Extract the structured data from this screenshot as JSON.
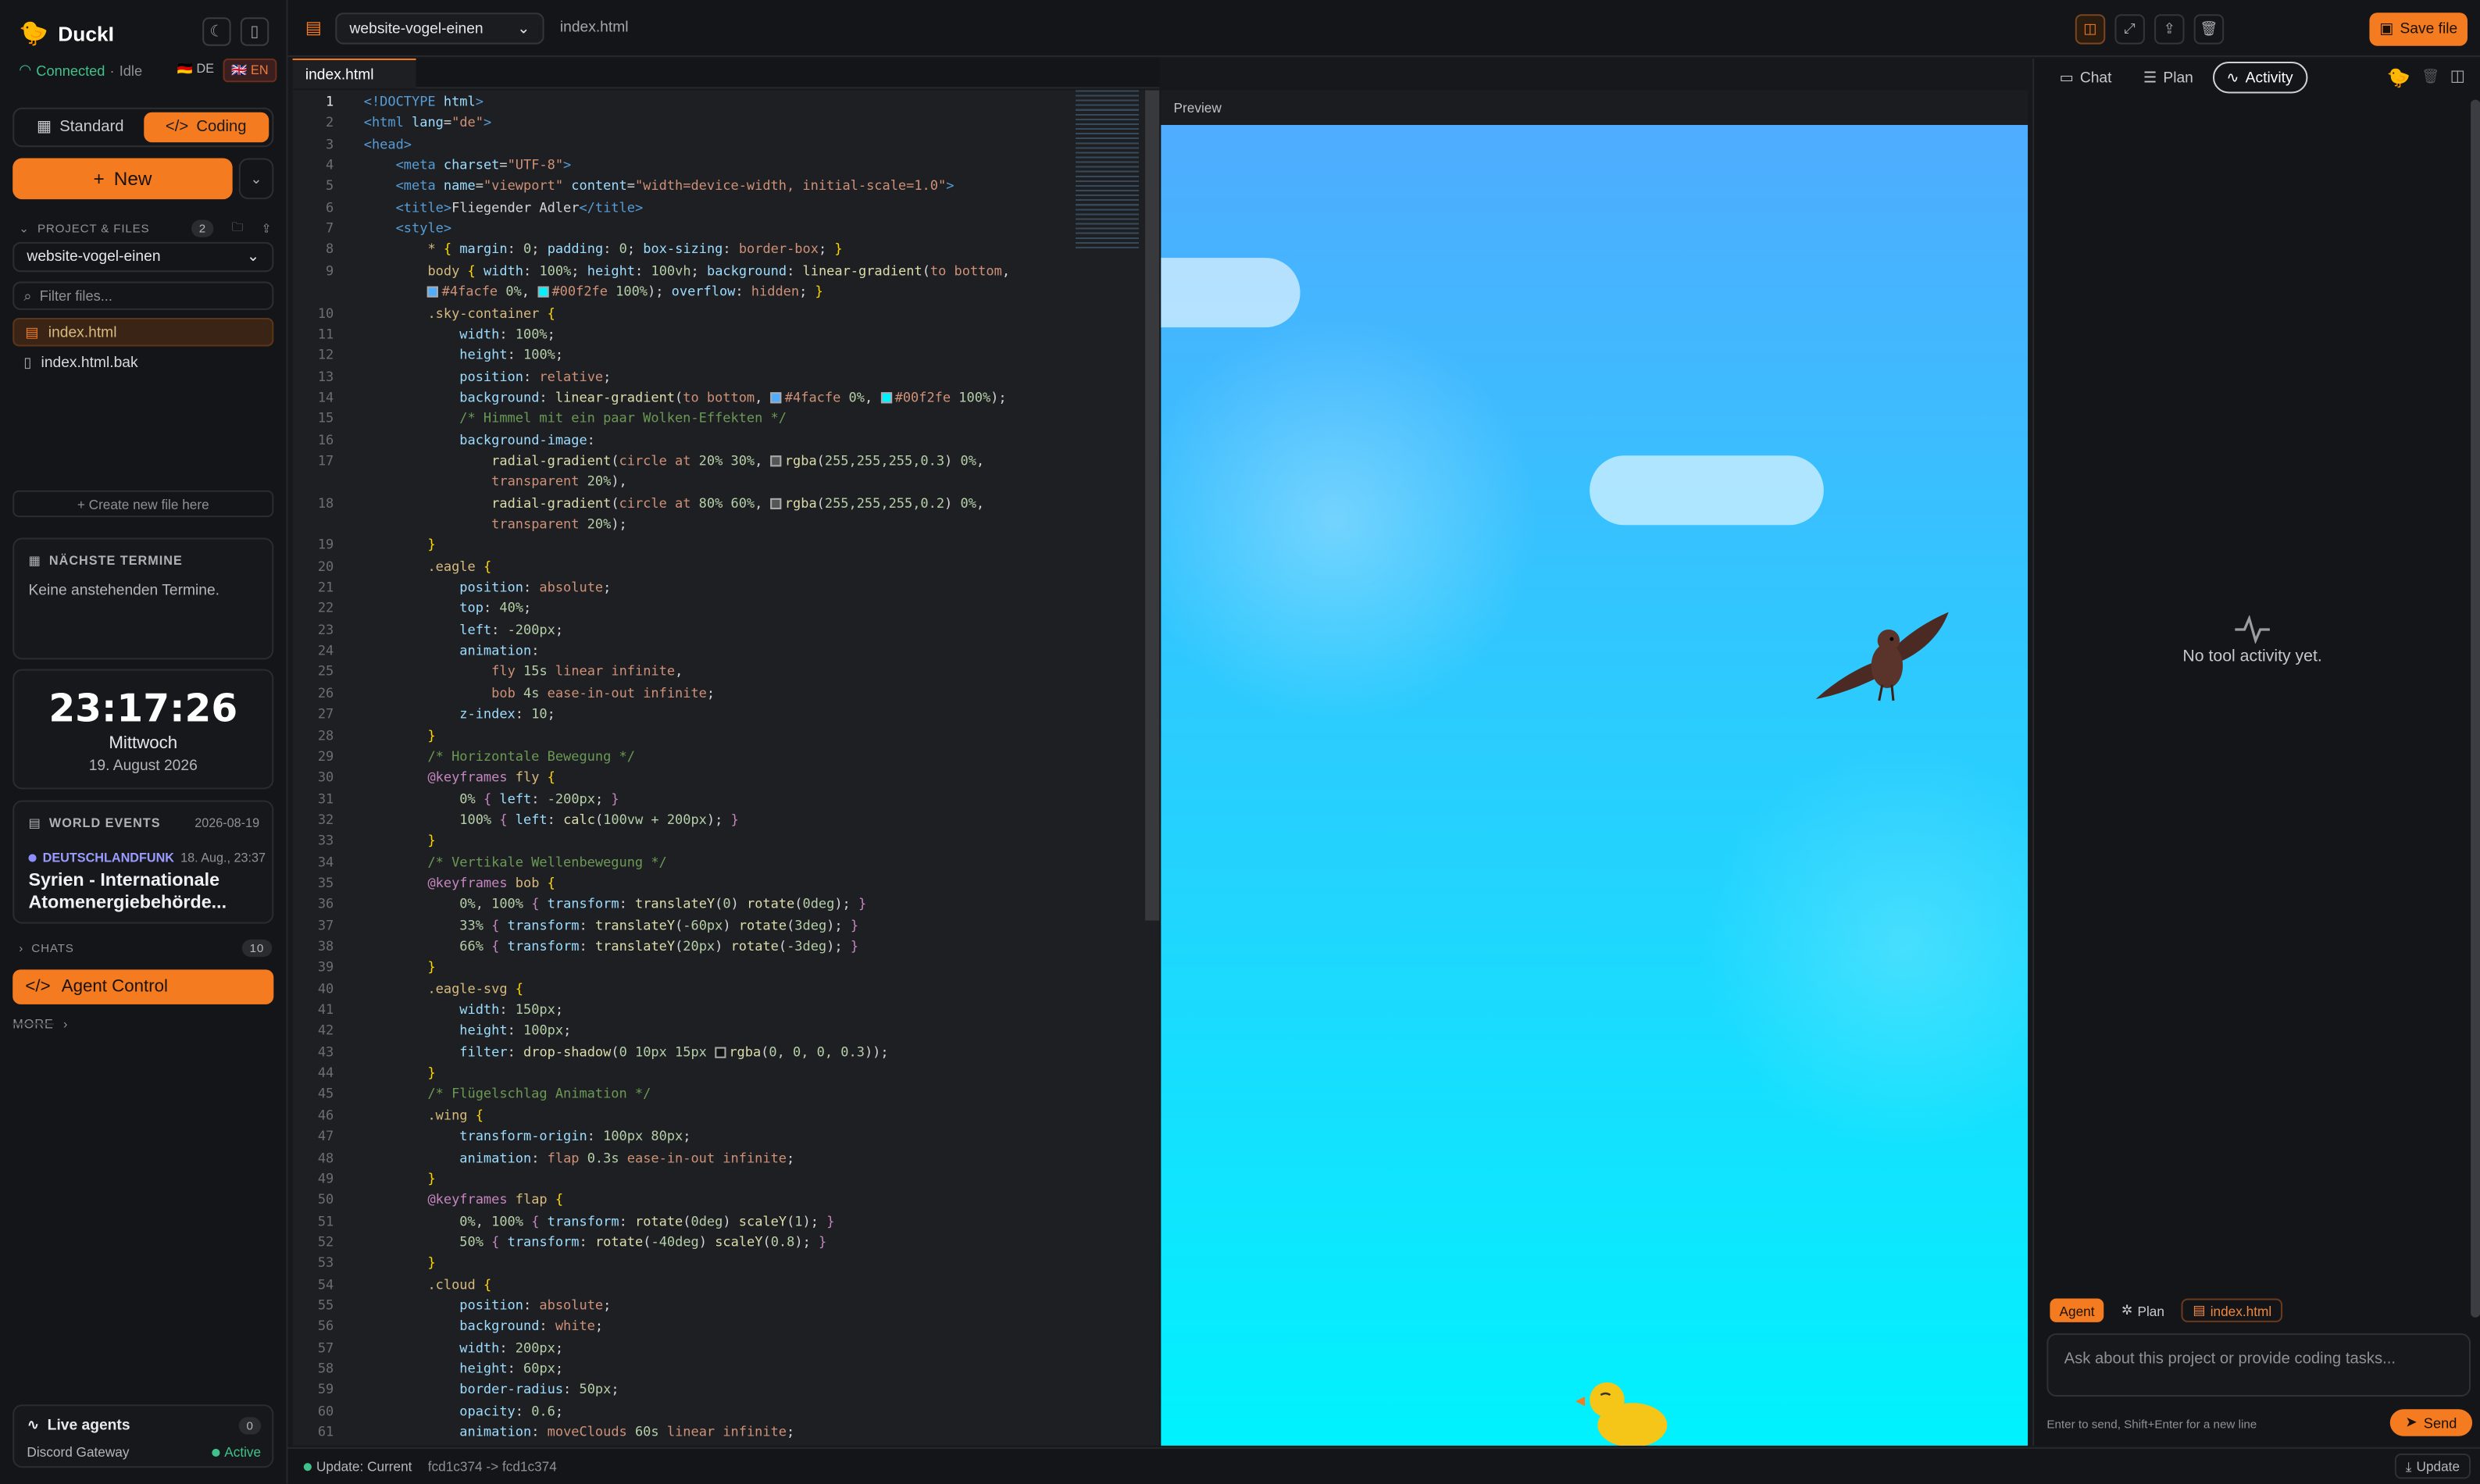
{
  "app": {
    "name": "DuckI",
    "status_connected": "Connected",
    "status_sep": " · ",
    "status_state": "Idle"
  },
  "langs": [
    {
      "code": "DE",
      "flag": "🇩🇪"
    },
    {
      "code": "EN",
      "flag": "🇬🇧"
    }
  ],
  "modes": {
    "standard": "Standard",
    "coding": "Coding"
  },
  "new_label": "New",
  "project": {
    "section_label": "PROJECT & FILES",
    "count": "2",
    "name": "website-vogel-einen",
    "filter_placeholder": "Filter files...",
    "files": [
      "index.html",
      "index.html.bak"
    ],
    "create_label": "+ Create new file here"
  },
  "appointments": {
    "title": "NÄCHSTE TERMINE",
    "empty": "Keine anstehenden Termine."
  },
  "clock": {
    "time": "23:17:26",
    "weekday": "Mittwoch",
    "date": "19. August 2026"
  },
  "world_events": {
    "title": "WORLD EVENTS",
    "date": "2026-08-19",
    "source": "DEUTSCHLANDFUNK",
    "time": "18. Aug., 23:37",
    "headline": "Syrien - Internationale Atomenergiebehörde..."
  },
  "chats": {
    "label": "CHATS",
    "count": "10"
  },
  "agent_control": "Agent Control",
  "more": "MORE",
  "live_agents": {
    "title": "Live agents",
    "count": "0",
    "gateway": "Discord Gateway",
    "state": "Active"
  },
  "topbar": {
    "project": "website-vogel-einen",
    "file": "index.html",
    "save": "Save file"
  },
  "editor": {
    "tab": "index.html",
    "lines": [
      {
        "n": "1",
        "t": "<span class='tg'>&lt;!DOCTYPE</span> <span class='at'>html</span><span class='tg'>&gt;</span>"
      },
      {
        "n": "2",
        "t": "<span class='tg'>&lt;html</span> <span class='at'>lang</span>=<span class='st'>\"de\"</span><span class='tg'>&gt;</span>"
      },
      {
        "n": "3",
        "t": "<span class='tg'>&lt;head&gt;</span>"
      },
      {
        "n": "4",
        "t": "    <span class='tg'>&lt;meta</span> <span class='at'>charset</span>=<span class='st'>\"UTF-8\"</span><span class='tg'>&gt;</span>"
      },
      {
        "n": "5",
        "t": "    <span class='tg'>&lt;meta</span> <span class='at'>name</span>=<span class='st'>\"viewport\"</span> <span class='at'>content</span>=<span class='st'>\"width=device-width, initial-scale=1.0\"</span><span class='tg'>&gt;</span>"
      },
      {
        "n": "6",
        "t": "    <span class='tg'>&lt;title&gt;</span>Fliegender Adler<span class='tg'>&lt;/title&gt;</span>"
      },
      {
        "n": "7",
        "t": "    <span class='tg'>&lt;style&gt;</span>"
      },
      {
        "n": "8",
        "t": "        <span class='sel'>*</span> <span class='br'>{</span> <span class='pr'>margin</span>: <span class='nm'>0</span>; <span class='pr'>padding</span>: <span class='nm'>0</span>; <span class='pr'>box-sizing</span>: <span class='vl'>border-box</span>; <span class='br'>}</span>"
      },
      {
        "n": "9",
        "t": "        <span class='sel'>body</span> <span class='br'>{</span> <span class='pr'>width</span>: <span class='nm'>100%</span>; <span class='pr'>height</span>: <span class='nm'>100vh</span>; <span class='pr'>background</span>: <span class='fn'>linear-gradient</span>(<span class='vl'>to bottom</span>,"
      },
      {
        "n": "",
        "t": "        <i class='sw' style='background:#4facfe'></i><span class='vl'>#4facfe</span> <span class='nm'>0%</span>, <i class='sw' style='background:#00f2fe'></i><span class='vl'>#00f2fe</span> <span class='nm'>100%</span>); <span class='pr'>overflow</span>: <span class='vl'>hidden</span>; <span class='br'>}</span>"
      },
      {
        "n": "10",
        "t": "        <span class='sel'>.sky-container</span> <span class='br'>{</span>"
      },
      {
        "n": "11",
        "t": "            <span class='pr'>width</span>: <span class='nm'>100%</span>;"
      },
      {
        "n": "12",
        "t": "            <span class='pr'>height</span>: <span class='nm'>100%</span>;"
      },
      {
        "n": "13",
        "t": "            <span class='pr'>position</span>: <span class='vl'>relative</span>;"
      },
      {
        "n": "14",
        "t": "            <span class='pr'>background</span>: <span class='fn'>linear-gradient</span>(<span class='vl'>to bottom</span>, <i class='sw' style='background:#4facfe'></i><span class='vl'>#4facfe</span> <span class='nm'>0%</span>, <i class='sw' style='background:#00f2fe'></i><span class='vl'>#00f2fe</span> <span class='nm'>100%</span>);"
      },
      {
        "n": "15",
        "t": "            <span class='cm'>/* Himmel mit ein paar Wolken-Effekten */</span>"
      },
      {
        "n": "16",
        "t": "            <span class='pr'>background-image</span>:"
      },
      {
        "n": "17",
        "t": "                <span class='fn'>radial-gradient</span>(<span class='vl'>circle at</span> <span class='nm'>20% 30%</span>, <i class='sw' style='background:#555'></i><span class='fn'>rgba</span>(<span class='nm'>255,255,255,0.3</span>) <span class='nm'>0%</span>,"
      },
      {
        "n": "",
        "t": "                <span class='vl'>transparent</span> <span class='nm'>20%</span>),"
      },
      {
        "n": "18",
        "t": "                <span class='fn'>radial-gradient</span>(<span class='vl'>circle at</span> <span class='nm'>80% 60%</span>, <i class='sw' style='background:#555'></i><span class='fn'>rgba</span>(<span class='nm'>255,255,255,0.2</span>) <span class='nm'>0%</span>,"
      },
      {
        "n": "",
        "t": "                <span class='vl'>transparent</span> <span class='nm'>20%</span>);"
      },
      {
        "n": "19",
        "t": "        <span class='br'>}</span>"
      },
      {
        "n": "20",
        "t": "        <span class='sel'>.eagle</span> <span class='br'>{</span>"
      },
      {
        "n": "21",
        "t": "            <span class='pr'>position</span>: <span class='vl'>absolute</span>;"
      },
      {
        "n": "22",
        "t": "            <span class='pr'>top</span>: <span class='nm'>40%</span>;"
      },
      {
        "n": "23",
        "t": "            <span class='pr'>left</span>: <span class='nm'>-200px</span>;"
      },
      {
        "n": "24",
        "t": "            <span class='pr'>animation</span>:"
      },
      {
        "n": "25",
        "t": "                <span class='vl'>fly</span> <span class='nm'>15s</span> <span class='vl'>linear infinite</span>,"
      },
      {
        "n": "26",
        "t": "                <span class='vl'>bob</span> <span class='nm'>4s</span> <span class='vl'>ease-in-out infinite</span>;"
      },
      {
        "n": "27",
        "t": "            <span class='pr'>z-index</span>: <span class='nm'>10</span>;"
      },
      {
        "n": "28",
        "t": "        <span class='br'>}</span>"
      },
      {
        "n": "29",
        "t": "        <span class='cm'>/* Horizontale Bewegung */</span>"
      },
      {
        "n": "30",
        "t": "        <span class='kw'>@keyframes</span> <span class='sel'>fly</span> <span class='br'>{</span>"
      },
      {
        "n": "31",
        "t": "            <span class='nm'>0%</span> <span class='kw'>{</span> <span class='pr'>left</span>: <span class='nm'>-200px</span>; <span class='kw'>}</span>"
      },
      {
        "n": "32",
        "t": "            <span class='nm'>100%</span> <span class='kw'>{</span> <span class='pr'>left</span>: <span class='fn'>calc</span>(<span class='nm'>100vw + 200px</span>); <span class='kw'>}</span>"
      },
      {
        "n": "33",
        "t": "        <span class='br'>}</span>"
      },
      {
        "n": "34",
        "t": "        <span class='cm'>/* Vertikale Wellenbewegung */</span>"
      },
      {
        "n": "35",
        "t": "        <span class='kw'>@keyframes</span> <span class='sel'>bob</span> <span class='br'>{</span>"
      },
      {
        "n": "36",
        "t": "            <span class='nm'>0%, 100%</span> <span class='kw'>{</span> <span class='pr'>transform</span>: <span class='fn'>translateY</span>(<span class='nm'>0</span>) <span class='fn'>rotate</span>(<span class='nm'>0deg</span>); <span class='kw'>}</span>"
      },
      {
        "n": "37",
        "t": "            <span class='nm'>33%</span> <span class='kw'>{</span> <span class='pr'>transform</span>: <span class='fn'>translateY</span>(<span class='nm'>-60px</span>) <span class='fn'>rotate</span>(<span class='nm'>3deg</span>); <span class='kw'>}</span>"
      },
      {
        "n": "38",
        "t": "            <span class='nm'>66%</span> <span class='kw'>{</span> <span class='pr'>transform</span>: <span class='fn'>translateY</span>(<span class='nm'>20px</span>) <span class='fn'>rotate</span>(<span class='nm'>-3deg</span>); <span class='kw'>}</span>"
      },
      {
        "n": "39",
        "t": "        <span class='br'>}</span>"
      },
      {
        "n": "40",
        "t": "        <span class='sel'>.eagle-svg</span> <span class='br'>{</span>"
      },
      {
        "n": "41",
        "t": "            <span class='pr'>width</span>: <span class='nm'>150px</span>;"
      },
      {
        "n": "42",
        "t": "            <span class='pr'>height</span>: <span class='nm'>100px</span>;"
      },
      {
        "n": "43",
        "t": "            <span class='pr'>filter</span>: <span class='fn'>drop-shadow</span>(<span class='nm'>0 10px 15px</span> <i class='sw' style='background:#111'></i><span class='fn'>rgba</span>(<span class='nm'>0, 0, 0, 0.3</span>));"
      },
      {
        "n": "44",
        "t": "        <span class='br'>}</span>"
      },
      {
        "n": "45",
        "t": "        <span class='cm'>/* Flügelschlag Animation */</span>"
      },
      {
        "n": "46",
        "t": "        <span class='sel'>.wing</span> <span class='br'>{</span>"
      },
      {
        "n": "47",
        "t": "            <span class='pr'>transform-origin</span>: <span class='nm'>100px 80px</span>;"
      },
      {
        "n": "48",
        "t": "            <span class='pr'>animation</span>: <span class='vl'>flap</span> <span class='nm'>0.3s</span> <span class='vl'>ease-in-out infinite</span>;"
      },
      {
        "n": "49",
        "t": "        <span class='br'>}</span>"
      },
      {
        "n": "50",
        "t": "        <span class='kw'>@keyframes</span> <span class='sel'>flap</span> <span class='br'>{</span>"
      },
      {
        "n": "51",
        "t": "            <span class='nm'>0%, 100%</span> <span class='kw'>{</span> <span class='pr'>transform</span>: <span class='fn'>rotate</span>(<span class='nm'>0deg</span>) <span class='fn'>scaleY</span>(<span class='nm'>1</span>); <span class='kw'>}</span>"
      },
      {
        "n": "52",
        "t": "            <span class='nm'>50%</span> <span class='kw'>{</span> <span class='pr'>transform</span>: <span class='fn'>rotate</span>(<span class='nm'>-40deg</span>) <span class='fn'>scaleY</span>(<span class='nm'>0.8</span>); <span class='kw'>}</span>"
      },
      {
        "n": "53",
        "t": "        <span class='br'>}</span>"
      },
      {
        "n": "54",
        "t": "        <span class='sel'>.cloud</span> <span class='br'>{</span>"
      },
      {
        "n": "55",
        "t": "            <span class='pr'>position</span>: <span class='vl'>absolute</span>;"
      },
      {
        "n": "56",
        "t": "            <span class='pr'>background</span>: <span class='vl'>white</span>;"
      },
      {
        "n": "57",
        "t": "            <span class='pr'>width</span>: <span class='nm'>200px</span>;"
      },
      {
        "n": "58",
        "t": "            <span class='pr'>height</span>: <span class='nm'>60px</span>;"
      },
      {
        "n": "59",
        "t": "            <span class='pr'>border-radius</span>: <span class='nm'>50px</span>;"
      },
      {
        "n": "60",
        "t": "            <span class='pr'>opacity</span>: <span class='nm'>0.6</span>;"
      },
      {
        "n": "61",
        "t": "            <span class='pr'>animation</span>: <span class='vl'>moveClouds</span> <span class='nm'>60s</span> <span class='vl'>linear infinite</span>;"
      }
    ]
  },
  "preview_label": "Preview",
  "right": {
    "tabs": [
      "Chat",
      "Plan",
      "Activity"
    ],
    "empty": "No tool activity yet.",
    "chips": [
      "Agent",
      "Plan",
      "index.html"
    ],
    "input_placeholder": "Ask about this project or provide coding tasks...",
    "hint": "Enter to send, Shift+Enter for a new line",
    "send": "Send"
  },
  "statusbar": {
    "update": "Update: Current",
    "commit": "fcd1c374 -> fcd1c374",
    "update_btn": "Update"
  },
  "colors": {
    "accent": "#f47b20",
    "connected": "#3fc28a",
    "sky_top": "#4facfe",
    "sky_bottom": "#00f2fe"
  }
}
